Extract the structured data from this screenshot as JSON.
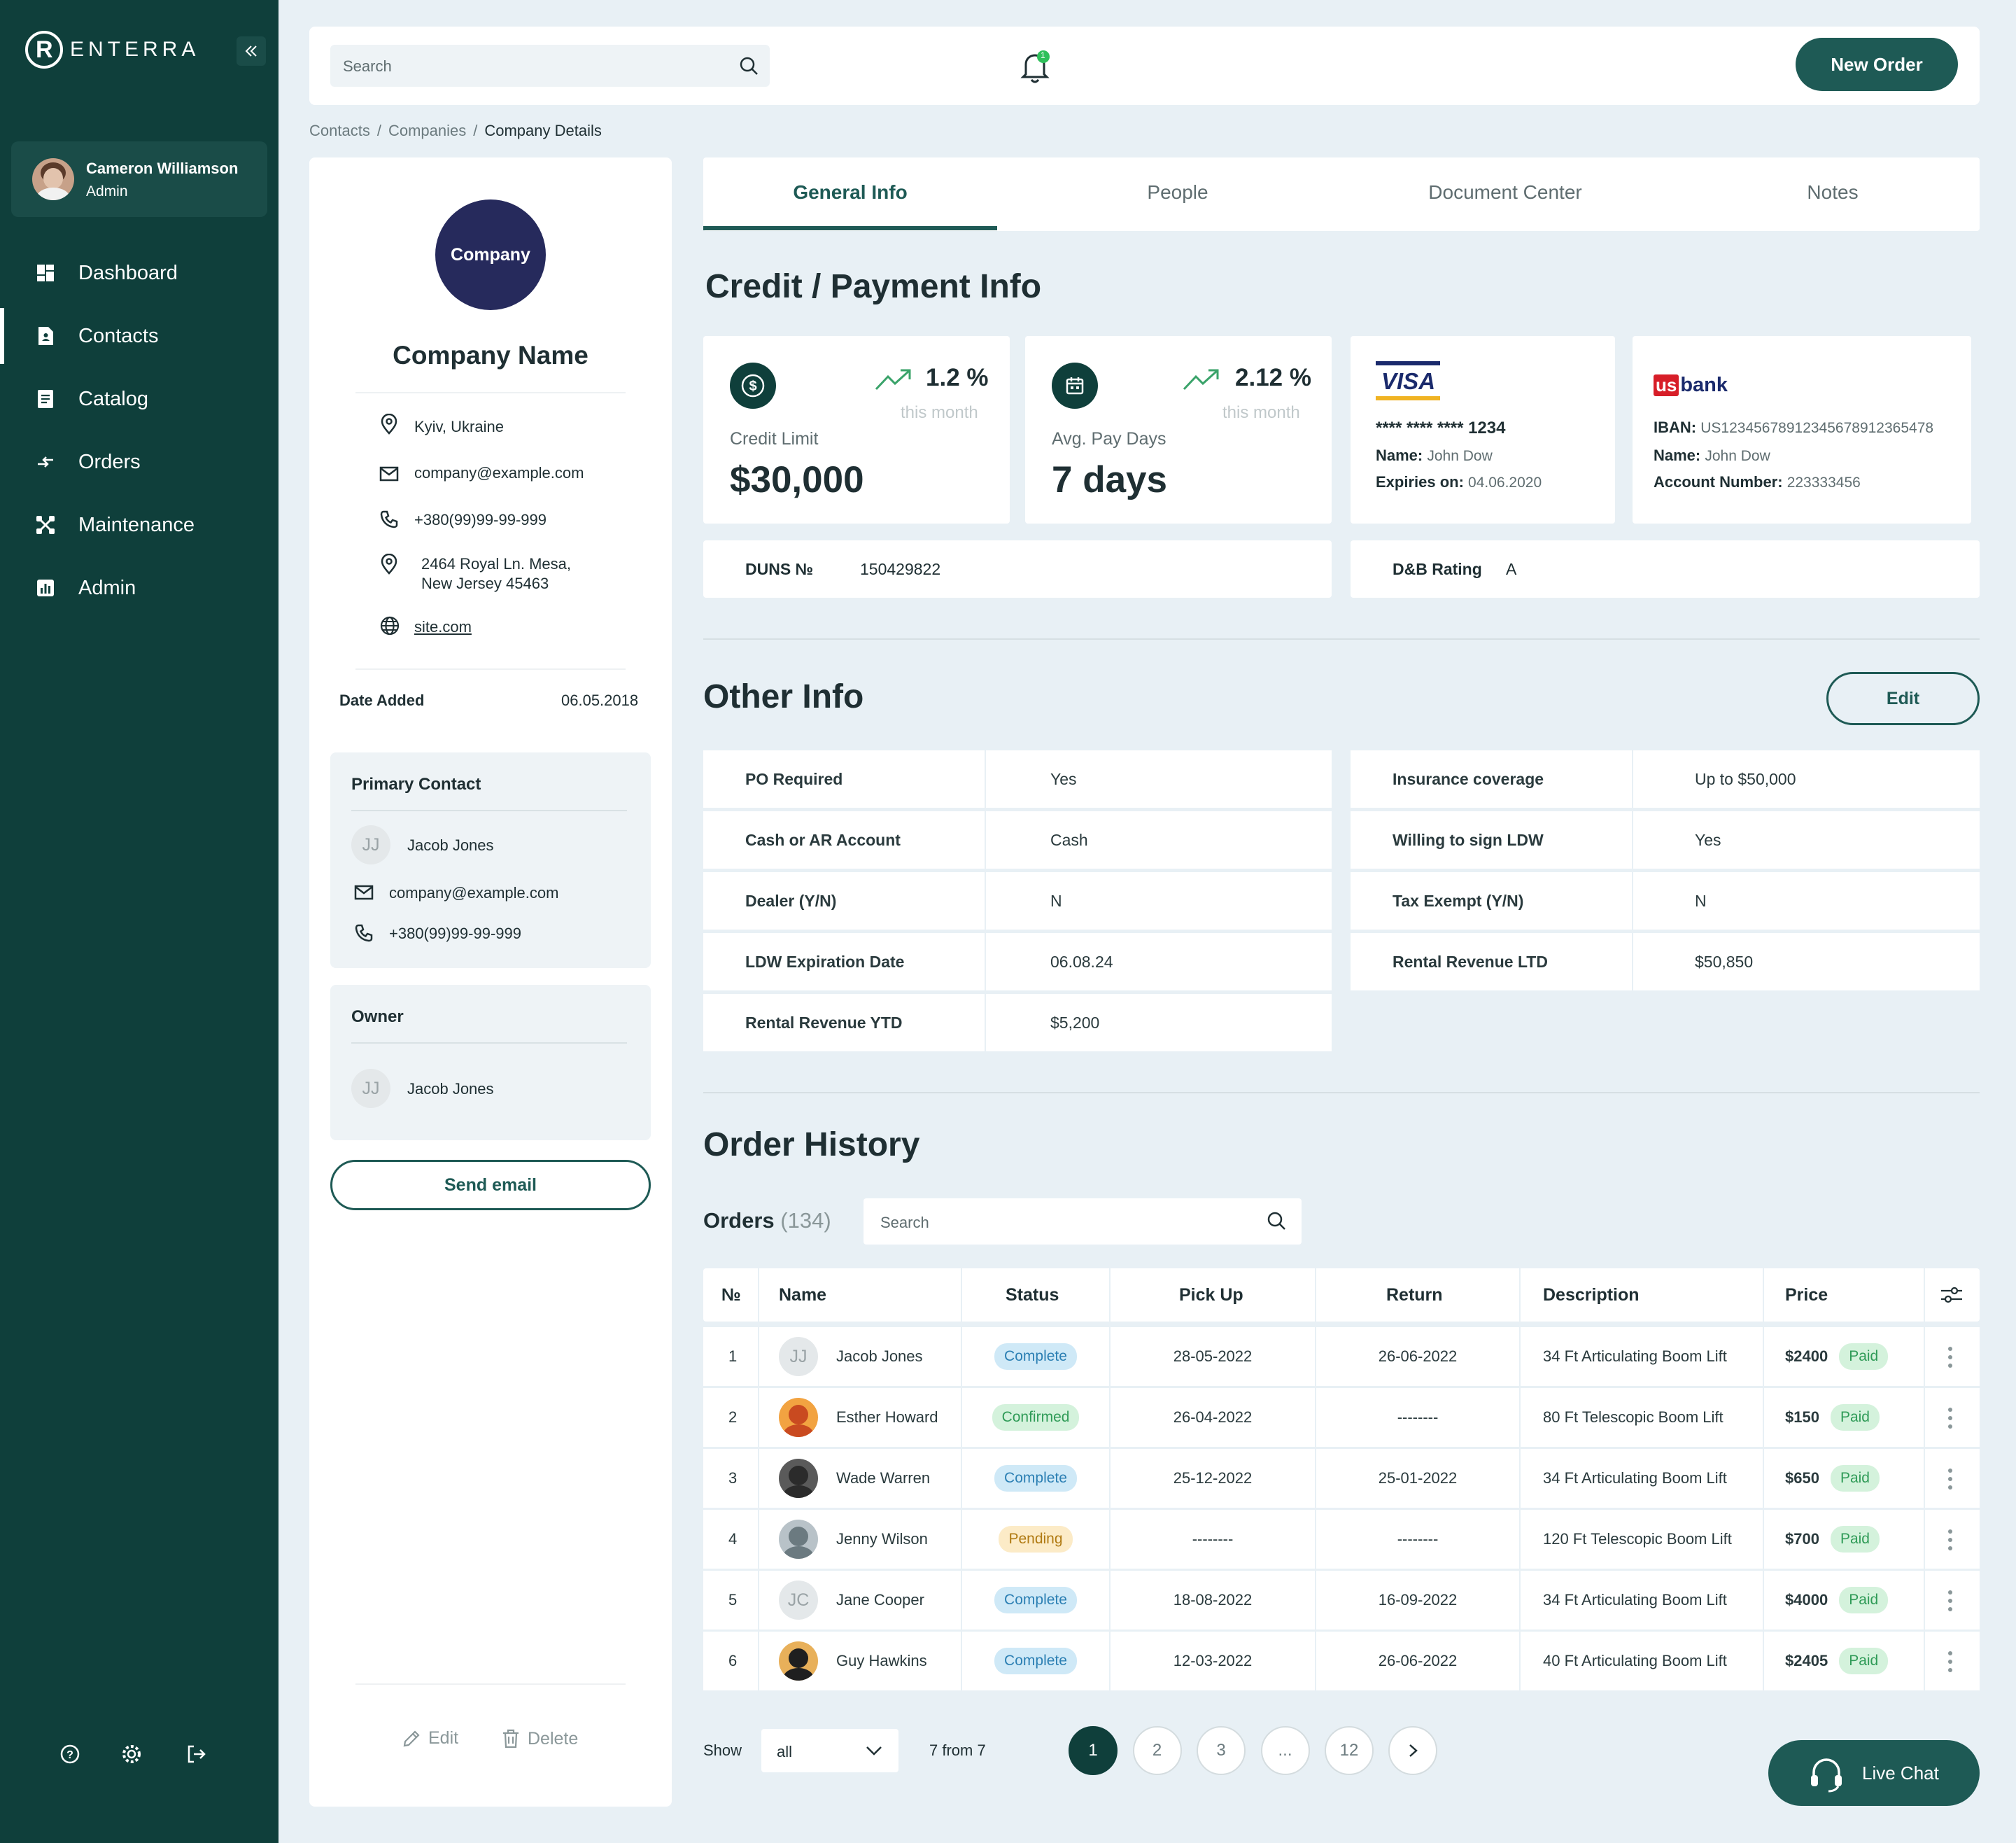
{
  "app": {
    "brand": "ENTERRA",
    "brand_letter": "R"
  },
  "user": {
    "name": "Cameron Williamson",
    "role": "Admin"
  },
  "nav": [
    {
      "label": "Dashboard",
      "icon": "dashboard-icon"
    },
    {
      "label": "Contacts",
      "icon": "contacts-icon",
      "active": true
    },
    {
      "label": "Catalog",
      "icon": "catalog-icon"
    },
    {
      "label": "Orders",
      "icon": "orders-icon"
    },
    {
      "label": "Maintenance",
      "icon": "maintenance-icon"
    },
    {
      "label": "Admin",
      "icon": "admin-icon"
    }
  ],
  "topbar": {
    "search_placeholder": "Search",
    "new_order": "New Order",
    "notification_count": "1"
  },
  "breadcrumb": {
    "a": "Contacts",
    "b": "Companies",
    "c": "Company Details",
    "sep": "/"
  },
  "company": {
    "logo_text": "Company",
    "name": "Company Name",
    "location": "Kyiv, Ukraine",
    "email": "company@example.com",
    "phone": "+380(99)99-99-999",
    "address1": "2464 Royal Ln. Mesa,",
    "address2": "New Jersey 45463",
    "site": "site.com",
    "date_added_label": "Date Added",
    "date_added": "06.05.2018"
  },
  "primary_contact": {
    "title": "Primary Contact",
    "initials": "JJ",
    "name": "Jacob Jones",
    "email": "company@example.com",
    "phone": "+380(99)99-99-999"
  },
  "owner": {
    "title": "Owner",
    "initials": "JJ",
    "name": "Jacob Jones"
  },
  "send_email": "Send email",
  "footer_actions": {
    "edit": "Edit",
    "delete": "Delete"
  },
  "tabs": [
    "General Info",
    "People",
    "Document Center",
    "Notes"
  ],
  "credit": {
    "title": "Credit / Payment Info",
    "limit": {
      "label": "Credit Limit",
      "value": "$30,000",
      "trend": "1.2 %",
      "period": "this month"
    },
    "paydays": {
      "label": "Avg. Pay Days",
      "value": "7 days",
      "trend": "2.12 %",
      "period": "this month"
    },
    "visa": {
      "brand": "VISA",
      "number": "**** **** **** 1234",
      "name_label": "Name:",
      "name": "John Dow",
      "exp_label": "Expiries on:",
      "exp": "04.06.2020"
    },
    "bank": {
      "brand_us": "us",
      "brand_bank": "bank",
      "iban_label": "IBAN:",
      "iban": "US12345678912345678912365478",
      "name_label": "Name:",
      "name": "John Dow",
      "acct_label": "Account Number:",
      "acct": "223333456"
    },
    "duns_label": "DUNS №",
    "duns": "150429822",
    "dnb_label": "D&B Rating",
    "dnb": "A"
  },
  "other": {
    "title": "Other Info",
    "edit": "Edit",
    "left": [
      {
        "k": "PO Required",
        "v": "Yes"
      },
      {
        "k": "Cash or AR Account",
        "v": "Cash"
      },
      {
        "k": "Dealer (Y/N)",
        "v": "N"
      },
      {
        "k": "LDW Expiration Date",
        "v": "06.08.24"
      },
      {
        "k": "Rental Revenue YTD",
        "v": "$5,200"
      }
    ],
    "right": [
      {
        "k": "Insurance coverage",
        "v": "Up to $50,000"
      },
      {
        "k": "Willing to sign LDW",
        "v": "Yes"
      },
      {
        "k": "Tax Exempt (Y/N)",
        "v": "N"
      },
      {
        "k": "Rental Revenue LTD",
        "v": "$50,850"
      }
    ]
  },
  "orders": {
    "section_title": "Order History",
    "label": "Orders",
    "count": "(134)",
    "search_placeholder": "Search",
    "columns": [
      "№",
      "Name",
      "Status",
      "Pick Up",
      "Return",
      "Description",
      "Price"
    ],
    "rows": [
      {
        "n": "1",
        "name": "Jacob Jones",
        "initials": "JJ",
        "status": "Complete",
        "pick": "28-05-2022",
        "ret": "26-06-2022",
        "desc": "34 Ft Articulating Boom Lift",
        "price": "$2400",
        "paid": "Paid"
      },
      {
        "n": "2",
        "name": "Esther Howard",
        "initials": "",
        "status": "Confirmed",
        "pick": "26-04-2022",
        "ret": "--------",
        "desc": "80 Ft Telescopic Boom Lift",
        "price": "$150",
        "paid": "Paid"
      },
      {
        "n": "3",
        "name": "Wade Warren",
        "initials": "",
        "status": "Complete",
        "pick": "25-12-2022",
        "ret": "25-01-2022",
        "desc": "34 Ft Articulating Boom Lift",
        "price": "$650",
        "paid": "Paid"
      },
      {
        "n": "4",
        "name": "Jenny Wilson",
        "initials": "",
        "status": "Pending",
        "pick": "--------",
        "ret": "--------",
        "desc": "120 Ft Telescopic Boom Lift",
        "price": "$700",
        "paid": "Paid"
      },
      {
        "n": "5",
        "name": "Jane Cooper",
        "initials": "JC",
        "status": "Complete",
        "pick": "18-08-2022",
        "ret": "16-09-2022",
        "desc": "34 Ft Articulating Boom Lift",
        "price": "$4000",
        "paid": "Paid"
      },
      {
        "n": "6",
        "name": "Guy Hawkins",
        "initials": "",
        "status": "Complete",
        "pick": "12-03-2022",
        "ret": "26-06-2022",
        "desc": "40 Ft Articulating Boom Lift",
        "price": "$2405",
        "paid": "Paid"
      }
    ],
    "show_label": "Show",
    "show_value": "all",
    "range": "7 from 7",
    "pages": [
      "1",
      "2",
      "3",
      "...",
      "12"
    ]
  },
  "live_chat": "Live Chat",
  "colors": {
    "primary": "#0f3f3b",
    "accent": "#1e5a55",
    "bg": "#e8f0f5",
    "green": "#2f9b57",
    "navy": "#262a5c"
  }
}
